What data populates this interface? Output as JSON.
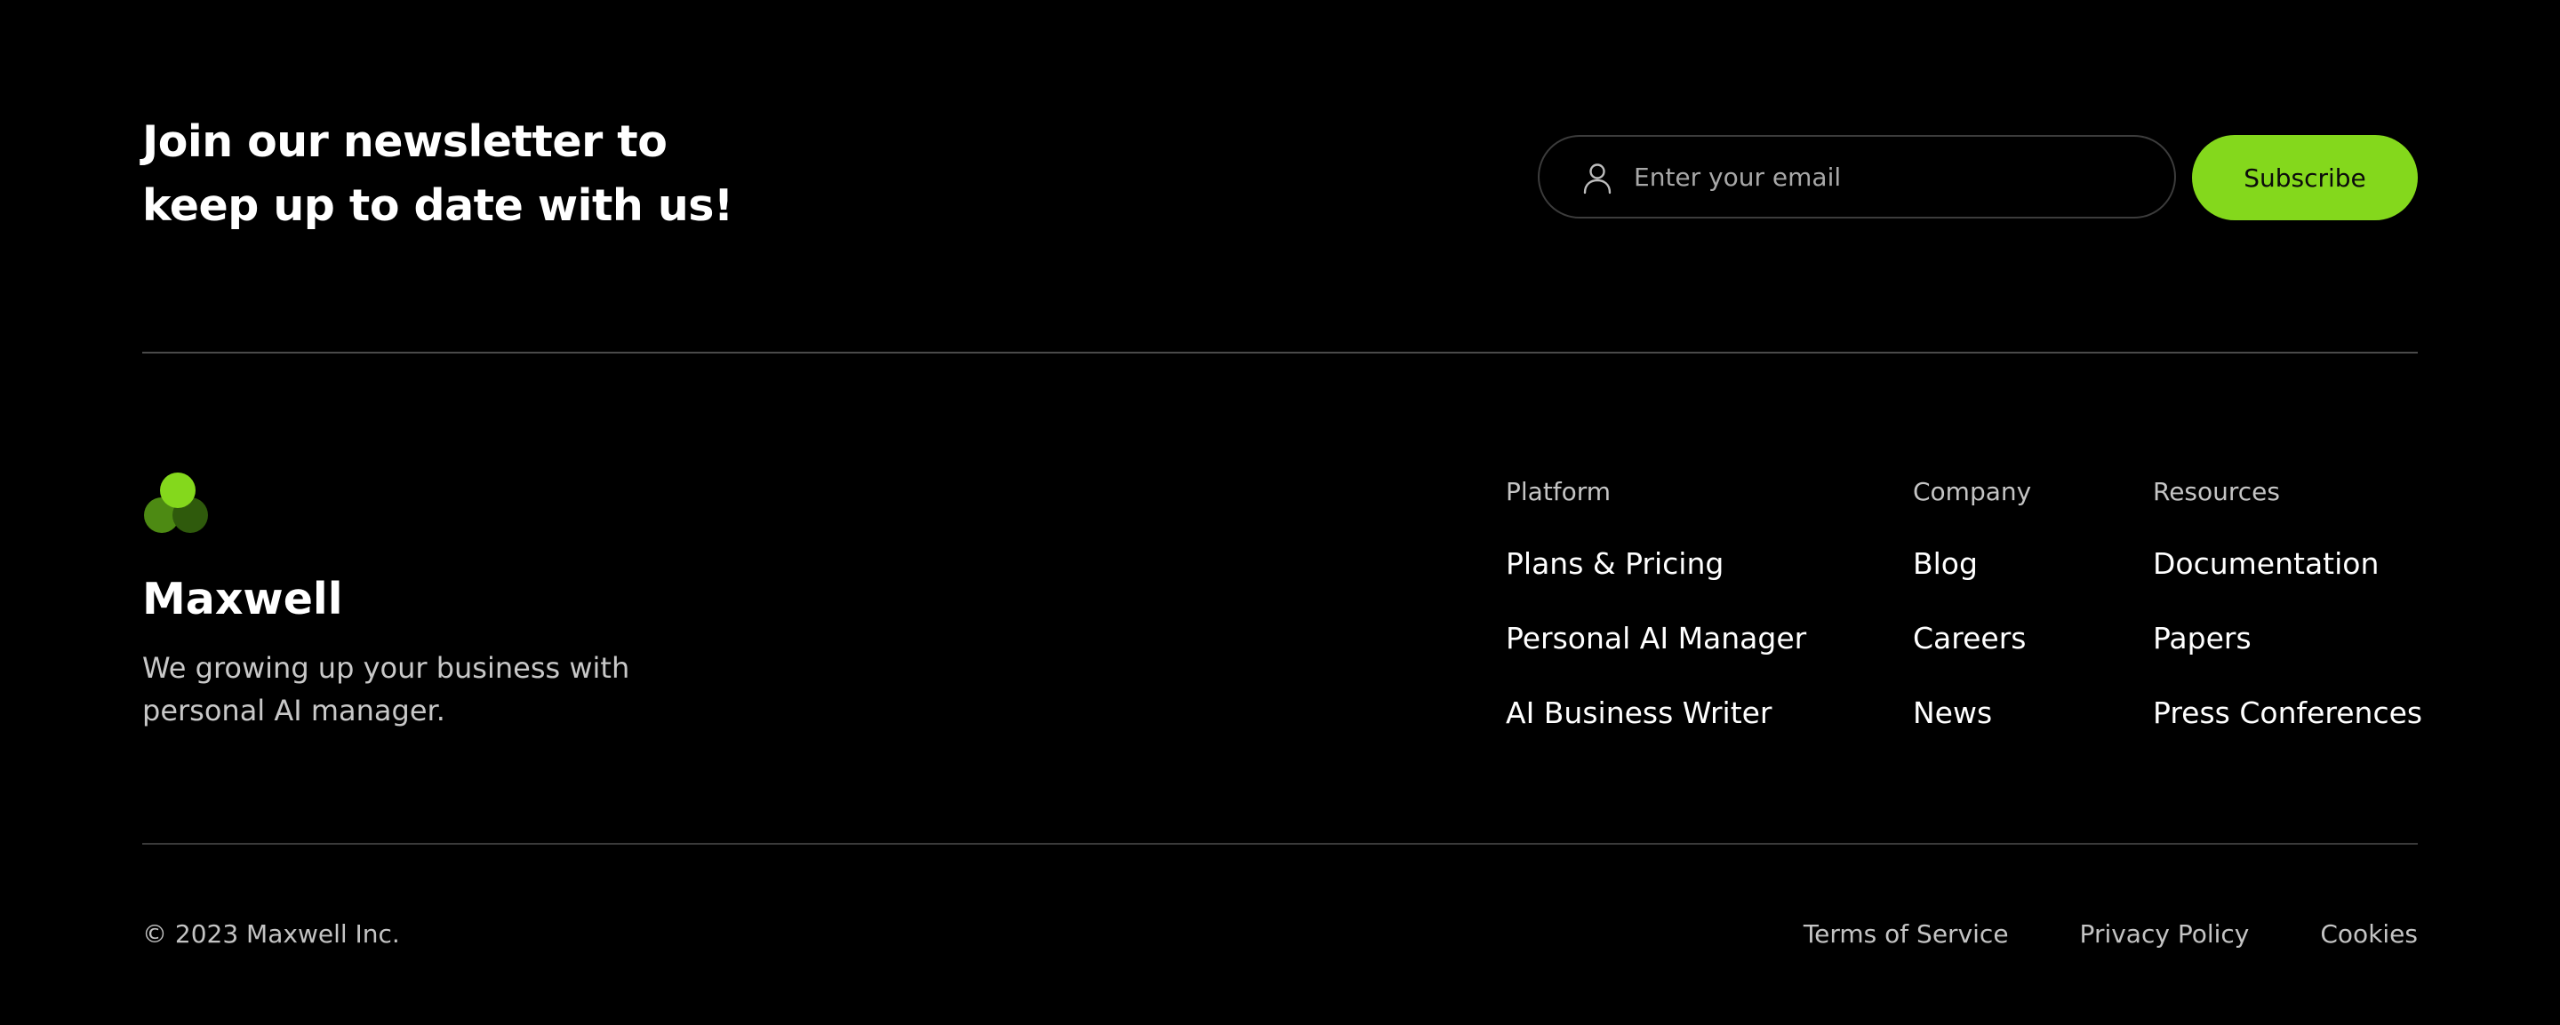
{
  "newsletter": {
    "title_line1": "Join our newsletter to",
    "title_line2": "keep up to date with us!",
    "email_placeholder": "Enter your email",
    "email_value": "",
    "email_icon": "user-icon",
    "subscribe_label": "Subscribe"
  },
  "brand": {
    "logo_icon": "three-circles-logo",
    "name": "Maxwell",
    "tagline_line1": "We growing up your business with",
    "tagline_line2": "personal AI manager."
  },
  "columns": {
    "platform": {
      "heading": "Platform",
      "links": [
        "Plans & Pricing",
        "Personal AI Manager",
        "AI Business Writer"
      ]
    },
    "company": {
      "heading": "Company",
      "links": [
        "Blog",
        "Careers",
        "News"
      ]
    },
    "resources": {
      "heading": "Resources",
      "links": [
        "Documentation",
        "Papers",
        "Press Conferences"
      ]
    }
  },
  "bottom": {
    "copyright": "© 2023 Maxwell Inc.",
    "legal_links": [
      "Terms of Service",
      "Privacy Policy",
      "Cookies"
    ]
  },
  "colors": {
    "background": "#000000",
    "accent": "#84d81c",
    "logo_light": "#84d81c",
    "logo_mid": "#4d8a13",
    "logo_dark": "#2f5a0c",
    "muted_text": "#c4c4c4"
  }
}
